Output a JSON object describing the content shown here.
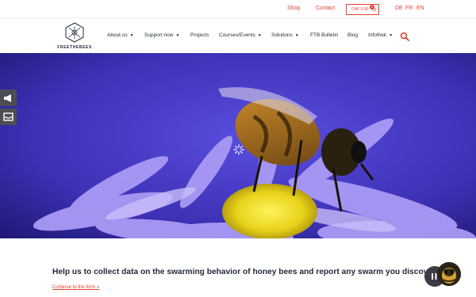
{
  "topbar": {
    "shop": "Shop",
    "contact": "Contact",
    "cart_label": "CHF 0.00",
    "cart_count": "0",
    "languages": [
      "DE",
      "FR",
      "EN"
    ]
  },
  "logo": {
    "text": "FREETHEBEES"
  },
  "nav": {
    "items": [
      {
        "label": "About us",
        "dropdown": true
      },
      {
        "label": "Support now",
        "dropdown": true
      },
      {
        "label": "Projects",
        "dropdown": false
      },
      {
        "label": "Courses/Events",
        "dropdown": true
      },
      {
        "label": "Solutions",
        "dropdown": true
      },
      {
        "label": "FTB Bulletin",
        "dropdown": false
      },
      {
        "label": "Blog",
        "dropdown": false
      },
      {
        "label": "Infothek",
        "dropdown": true
      }
    ]
  },
  "content": {
    "title": "Help us to collect data on the swarming behavior of honey bees and report any swarm you discover!",
    "link": "Continue to the form »"
  },
  "colors": {
    "accent": "#e0412f",
    "nav_text": "#1f2a3a",
    "side_btn": "#4d4d55"
  },
  "icons": [
    "cart-icon",
    "search-icon",
    "megaphone-icon",
    "inbox-icon",
    "loading-spinner-icon",
    "pause-icon"
  ]
}
